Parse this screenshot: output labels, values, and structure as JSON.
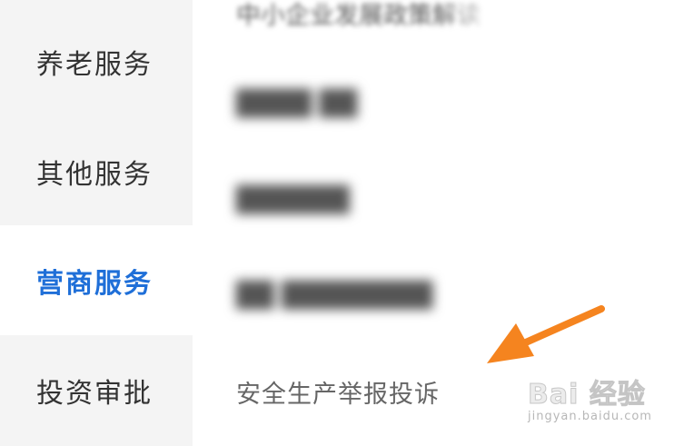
{
  "sidebar": {
    "items": [
      {
        "label": "养老服务",
        "active": false
      },
      {
        "label": "其他服务",
        "active": false
      },
      {
        "label": "营商服务",
        "active": true
      },
      {
        "label": "投资审批",
        "active": false
      }
    ]
  },
  "content": {
    "items": [
      {
        "label": "中小企业发展政策解读",
        "blurred": true
      },
      {
        "label": "████ ██",
        "blurred": true
      },
      {
        "label": "██████",
        "blurred": true
      },
      {
        "label": "██ ████████",
        "blurred": true
      },
      {
        "label": "安全生产举报投诉",
        "blurred": false
      }
    ]
  },
  "annotation": {
    "arrow_icon": "arrow-pointer-icon",
    "arrow_color": "#f5841f"
  },
  "watermark": {
    "brand": "Bai 经验",
    "url": "jingyan.baidu.com"
  },
  "colors": {
    "active_text": "#1f6fd8",
    "sidebar_bg": "#f4f4f4",
    "text": "#333333"
  }
}
